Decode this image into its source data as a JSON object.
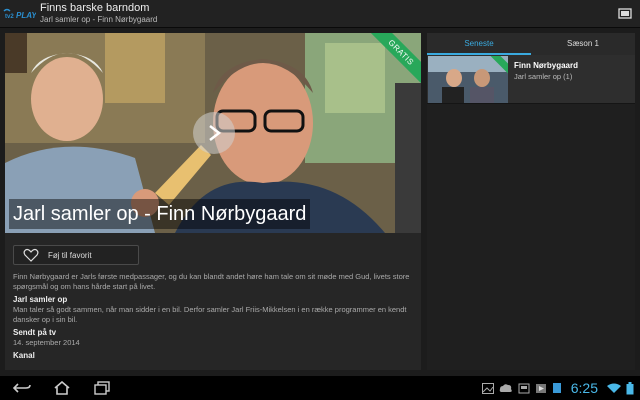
{
  "header": {
    "logo_text": "PLAY",
    "title": "Finns barske barndom",
    "subtitle": "Jarl samler op - Finn Nørbygaard"
  },
  "hero": {
    "title": "Jarl samler op - Finn Nørbygaard",
    "badge": "GRATIS"
  },
  "favorite_button": {
    "label": "Føj til favorit"
  },
  "details": {
    "description": "Finn Nørbygaard er Jarls første medpassager, og du kan blandt andet høre ham tale om sit møde med Gud, livets store spørgsmål og om hans hårde start på livet.",
    "program_heading": "Jarl samler op",
    "program_text": "Man taler så godt sammen, når man sidder i en bil. Derfor samler Jarl Friis-Mikkelsen i en række programmer en kendt dansker op i sin bil.",
    "aired_heading": "Sendt på tv",
    "aired_date": "14. september 2014",
    "channel_heading": "Kanal"
  },
  "sidebar": {
    "tabs": [
      {
        "label": "Seneste",
        "active": true
      },
      {
        "label": "Sæson 1",
        "active": false
      }
    ],
    "episodes": [
      {
        "title": "Finn Nørbygaard",
        "subtitle": "Jarl samler op (1)"
      }
    ]
  },
  "statusbar": {
    "time": "6:25"
  },
  "colors": {
    "accent": "#3aaadf",
    "badge": "#28a85a",
    "background": "#1c1c1c"
  }
}
